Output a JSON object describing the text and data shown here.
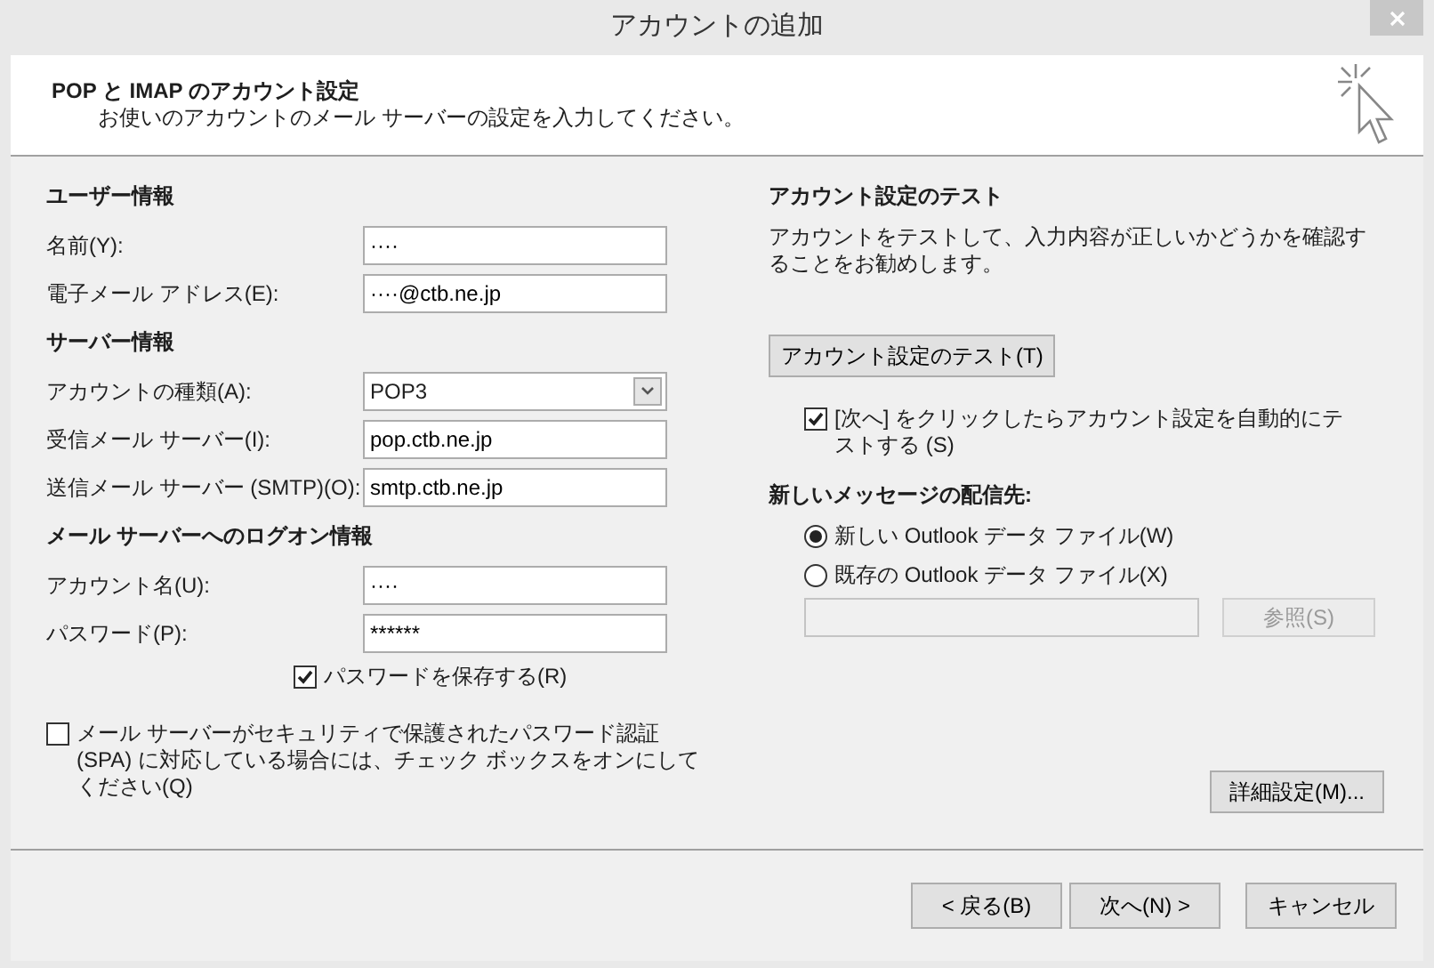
{
  "window": {
    "title": "アカウントの追加"
  },
  "header": {
    "title": "POP と IMAP のアカウント設定",
    "subtitle": "お使いのアカウントのメール サーバーの設定を入力してください。"
  },
  "user_info": {
    "heading": "ユーザー情報",
    "fields": [
      {
        "kind": "text",
        "label": "名前(Y):",
        "value": "····"
      },
      {
        "kind": "text",
        "label": "電子メール アドレス(E):",
        "value": "····@ctb.ne.jp"
      }
    ]
  },
  "server_info": {
    "heading": "サーバー情報",
    "fields": [
      {
        "kind": "select",
        "label": "アカウントの種類(A):",
        "value": "POP3"
      },
      {
        "kind": "text",
        "label": "受信メール サーバー(I):",
        "value": "pop.ctb.ne.jp"
      },
      {
        "kind": "text",
        "label": "送信メール サーバー (SMTP)(O):",
        "value": "smtp.ctb.ne.jp"
      }
    ]
  },
  "logon_info": {
    "heading": "メール サーバーへのログオン情報",
    "fields": [
      {
        "kind": "text",
        "label": "アカウント名(U):",
        "value": "····"
      },
      {
        "kind": "text",
        "label": "パスワード(P):",
        "value": "******"
      }
    ],
    "remember_password": {
      "label": "パスワードを保存する(R)",
      "checked": true
    },
    "spa": {
      "label": "メール サーバーがセキュリティで保護されたパスワード認証 (SPA) に対応している場合には、チェック ボックスをオンにしてください(Q)",
      "checked": false
    }
  },
  "test": {
    "heading": "アカウント設定のテスト",
    "description": "アカウントをテストして、入力内容が正しいかどうかを確認することをお勧めします。",
    "button": "アカウント設定のテスト(T)",
    "auto_test": {
      "label": "[次へ] をクリックしたらアカウント設定を自動的にテストする (S)",
      "checked": true
    }
  },
  "delivery": {
    "heading": "新しいメッセージの配信先:",
    "options": [
      {
        "label": "新しい Outlook データ ファイル(W)",
        "selected": true
      },
      {
        "label": "既存の Outlook データ ファイル(X)",
        "selected": false
      }
    ],
    "browse_button": {
      "label": "参照(S)",
      "disabled": true
    }
  },
  "more_settings_button": "詳細設定(M)...",
  "footer_buttons": [
    "< 戻る(B)",
    "次へ(N) >",
    "キャンセル"
  ]
}
